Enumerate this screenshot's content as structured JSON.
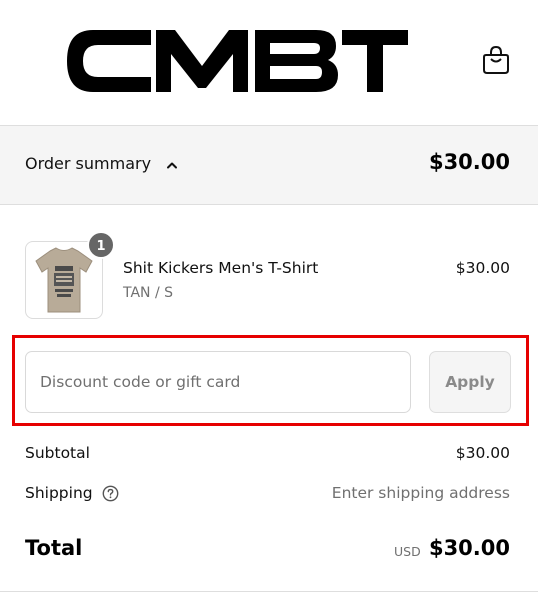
{
  "brand": {
    "logo_text": "CMBT"
  },
  "header": {
    "cart_icon": "shopping-bag-icon"
  },
  "summary": {
    "label": "Order summary",
    "toggle_icon": "chevron-up-icon",
    "total": "$30.00"
  },
  "line_item": {
    "quantity": "1",
    "name": "Shit Kickers Men's T-Shirt",
    "variant": "TAN / S",
    "price": "$30.00"
  },
  "discount": {
    "placeholder": "Discount code or gift card",
    "value": "",
    "apply_label": "Apply"
  },
  "totals": {
    "subtotal_label": "Subtotal",
    "subtotal_value": "$30.00",
    "shipping_label": "Shipping",
    "shipping_help_icon": "question-circle-icon",
    "shipping_value": "Enter shipping address",
    "total_label": "Total",
    "currency": "USD",
    "total_value": "$30.00"
  },
  "colors": {
    "highlight": "#e60000",
    "summary_bg": "#f5f5f5",
    "badge": "#666666",
    "muted_text": "#707070"
  }
}
